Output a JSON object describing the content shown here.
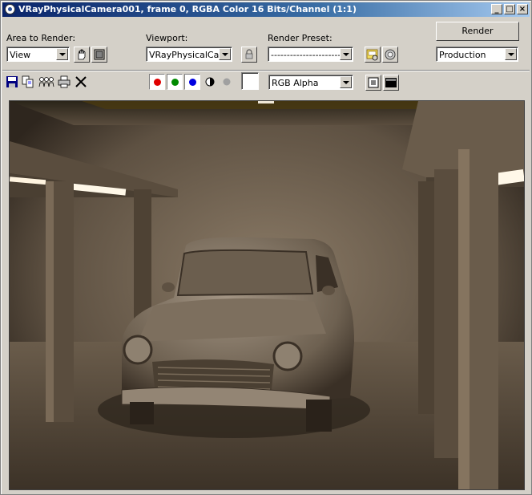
{
  "window": {
    "title": "VRayPhysicalCamera001, frame 0, RGBA Color 16 Bits/Channel (1:1)",
    "controls": [
      "_",
      "□",
      "×"
    ]
  },
  "area_to_render": {
    "label": "Area to Render:",
    "value": "View"
  },
  "viewport": {
    "label": "Viewport:",
    "value": "VRayPhysicalCame"
  },
  "render_preset": {
    "label": "Render Preset:",
    "value": "--------------------------"
  },
  "render_button": {
    "label": "Render"
  },
  "production": {
    "value": "Production"
  },
  "channel": {
    "value": "RGB Alpha"
  },
  "colors": {
    "red": "#e00000",
    "green": "#008a00",
    "blue": "#0000e0",
    "title_start": "#0a246a",
    "title_end": "#a6caf0"
  },
  "toolbar_icons": [
    "save-icon",
    "copy-icon",
    "clone-icon",
    "print-icon",
    "clear-icon"
  ],
  "render_image": {
    "subject": "garage-car-render"
  }
}
